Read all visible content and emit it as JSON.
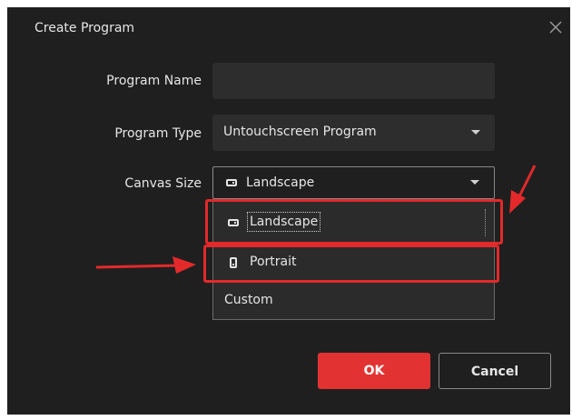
{
  "dialog": {
    "title": "Create Program",
    "close_icon": "close-icon"
  },
  "form": {
    "program_name": {
      "label": "Program Name",
      "value": ""
    },
    "program_type": {
      "label": "Program Type",
      "value": "Untouchscreen Program"
    },
    "canvas_size": {
      "label": "Canvas Size",
      "value": "Landscape",
      "icon": "landscape-icon",
      "options": [
        {
          "label": "Landscape",
          "icon": "landscape-icon"
        },
        {
          "label": "Portrait",
          "icon": "portrait-icon"
        },
        {
          "label": "Custom",
          "icon": ""
        }
      ]
    }
  },
  "buttons": {
    "ok_label": "OK",
    "cancel_label": "Cancel"
  },
  "colors": {
    "dialog_bg": "#1f1f1f",
    "field_bg": "#2d2d2d",
    "accent_red": "#e23232",
    "annotation_red": "#e3292a"
  }
}
